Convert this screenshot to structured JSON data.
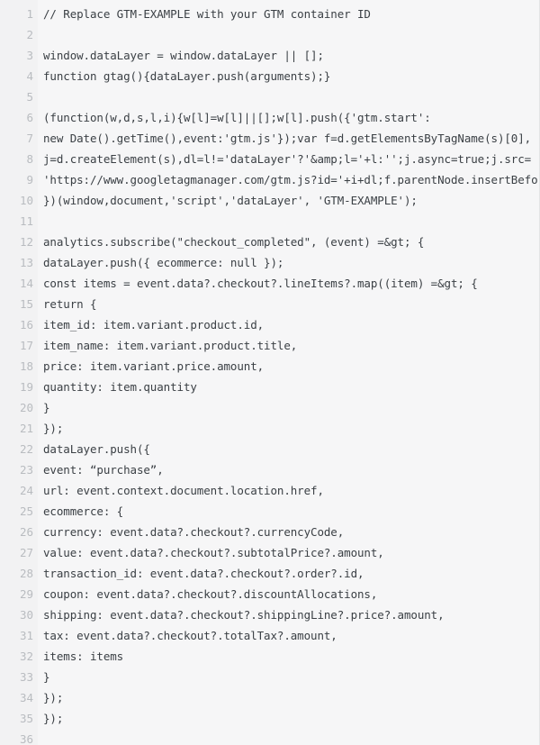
{
  "editor": {
    "language": "javascript",
    "background_color": "#f6f6f7",
    "gutter_color": "#f2f2f3",
    "text_color": "#3b4045",
    "line_number_color": "#b9bcc0",
    "first_line_number": 1,
    "last_line_number": 36,
    "total_lines": 36,
    "lines": [
      {
        "n": "1",
        "text": "// Replace GTM-EXAMPLE with your GTM container ID"
      },
      {
        "n": "2",
        "text": ""
      },
      {
        "n": "3",
        "text": "window.dataLayer = window.dataLayer || [];"
      },
      {
        "n": "4",
        "text": "function gtag(){dataLayer.push(arguments);}"
      },
      {
        "n": "5",
        "text": ""
      },
      {
        "n": "6",
        "text": "(function(w,d,s,l,i){w[l]=w[l]||[];w[l].push({'gtm.start':"
      },
      {
        "n": "7",
        "text": "new Date().getTime(),event:'gtm.js'});var f=d.getElementsByTagName(s)[0],"
      },
      {
        "n": "8",
        "text": "j=d.createElement(s),dl=l!='dataLayer'?'&amp;l='+l:'';j.async=true;j.src="
      },
      {
        "n": "9",
        "text": "'https://www.googletagmanager.com/gtm.js?id='+i+dl;f.parentNode.insertBefore(j,f);"
      },
      {
        "n": "10",
        "text": "})(window,document,'script','dataLayer', 'GTM-EXAMPLE');"
      },
      {
        "n": "11",
        "text": ""
      },
      {
        "n": "12",
        "text": "analytics.subscribe(\"checkout_completed\", (event) =&gt; {"
      },
      {
        "n": "13",
        "text": "dataLayer.push({ ecommerce: null });"
      },
      {
        "n": "14",
        "text": "const items = event.data?.checkout?.lineItems?.map((item) =&gt; {"
      },
      {
        "n": "15",
        "text": "return {"
      },
      {
        "n": "16",
        "text": "item_id: item.variant.product.id,"
      },
      {
        "n": "17",
        "text": "item_name: item.variant.product.title,"
      },
      {
        "n": "18",
        "text": "price: item.variant.price.amount,"
      },
      {
        "n": "19",
        "text": "quantity: item.quantity"
      },
      {
        "n": "20",
        "text": "}"
      },
      {
        "n": "21",
        "text": "});"
      },
      {
        "n": "22",
        "text": "dataLayer.push({"
      },
      {
        "n": "23",
        "text": "event: “purchase”,"
      },
      {
        "n": "24",
        "text": "url: event.context.document.location.href,"
      },
      {
        "n": "25",
        "text": "ecommerce: {"
      },
      {
        "n": "26",
        "text": "currency: event.data?.checkout?.currencyCode,"
      },
      {
        "n": "27",
        "text": "value: event.data?.checkout?.subtotalPrice?.amount,"
      },
      {
        "n": "28",
        "text": "transaction_id: event.data?.checkout?.order?.id,"
      },
      {
        "n": "29",
        "text": "coupon: event.data?.checkout?.discountAllocations,"
      },
      {
        "n": "30",
        "text": "shipping: event.data?.checkout?.shippingLine?.price?.amount,"
      },
      {
        "n": "31",
        "text": "tax: event.data?.checkout?.totalTax?.amount,"
      },
      {
        "n": "32",
        "text": "items: items"
      },
      {
        "n": "33",
        "text": "}"
      },
      {
        "n": "34",
        "text": "});"
      },
      {
        "n": "35",
        "text": "});"
      },
      {
        "n": "36",
        "text": ""
      }
    ]
  }
}
